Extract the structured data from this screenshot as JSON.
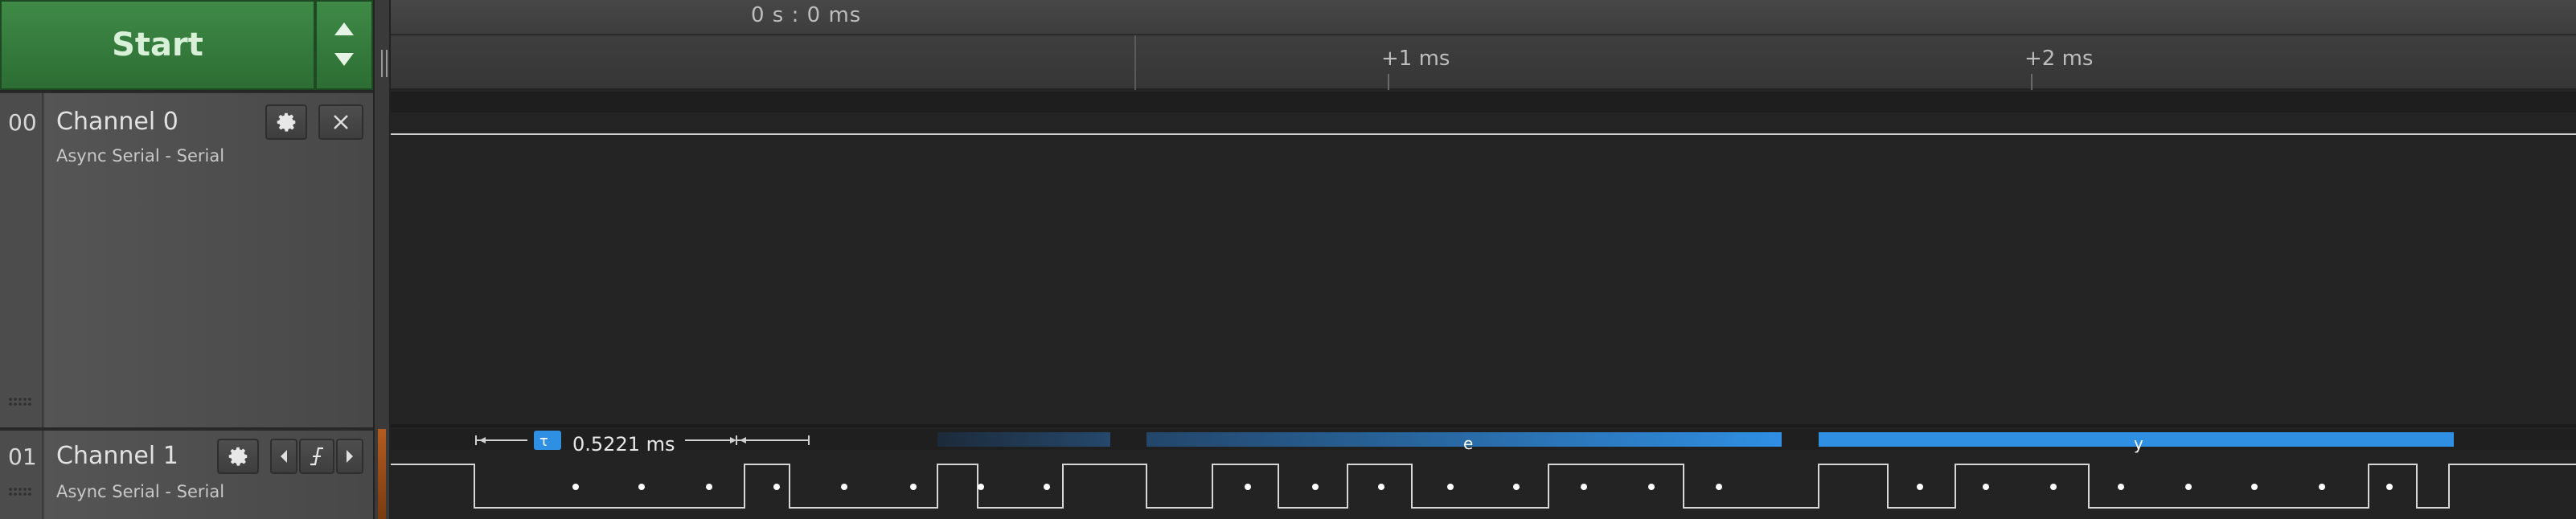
{
  "toolbar": {
    "start_label": "Start"
  },
  "timeline": {
    "absolute_time": "0 s : 0 ms",
    "ticks": [
      "+1 ms",
      "+2 ms"
    ]
  },
  "channels": [
    {
      "num": "00",
      "name": "Channel 0",
      "analyzer": "Async Serial - Serial"
    },
    {
      "num": "01",
      "name": "Channel 1",
      "analyzer": "Async Serial - Serial"
    }
  ],
  "measurement": {
    "width_label": "0.5221 ms",
    "trigger_glyph": "τ"
  },
  "decoded": [
    {
      "label": "e"
    },
    {
      "label": "y"
    }
  ],
  "icons": {
    "settings": "gear-icon",
    "close": "close-icon",
    "nav_prev": "chevron-left-icon",
    "trigger": "rising-edge-icon",
    "nav_next": "chevron-right-icon"
  },
  "colors": {
    "start_green": "#2f7a38",
    "decode_blue": "#2f8fe3",
    "ch1_marker": "#b35b1e"
  }
}
